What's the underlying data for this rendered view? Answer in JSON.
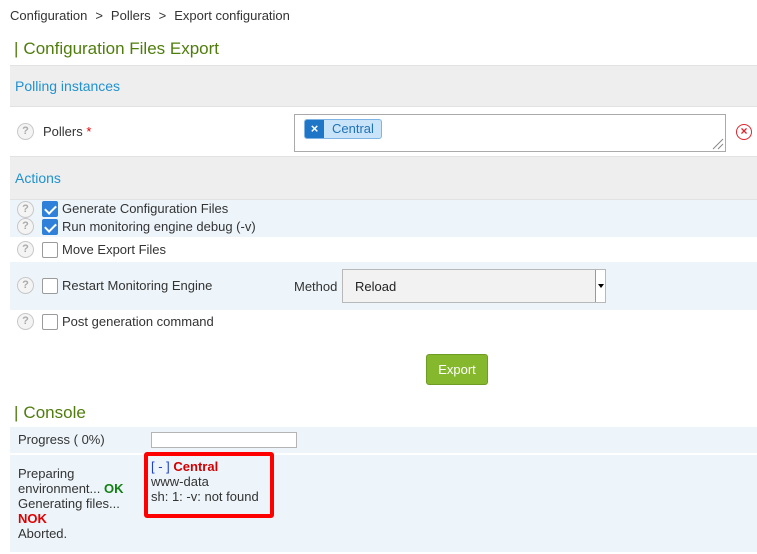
{
  "breadcrumb": {
    "items": [
      "Configuration",
      "Pollers",
      "Export configuration"
    ],
    "separator": ">"
  },
  "page_title": "Configuration Files Export",
  "polling_section": {
    "header": "Polling instances",
    "pollers_label": "Pollers",
    "required_mark": "*",
    "selected_pollers": [
      "Central"
    ],
    "remove_tag_symbol": "×"
  },
  "actions_section": {
    "header": "Actions",
    "items": [
      {
        "label": "Generate Configuration Files",
        "checked": true
      },
      {
        "label": "Run monitoring engine debug (-v)",
        "checked": true
      },
      {
        "label": "Move Export Files",
        "checked": false
      },
      {
        "label": "Restart Monitoring Engine",
        "checked": false
      },
      {
        "label": "Post generation command",
        "checked": false
      }
    ],
    "method_label": "Method",
    "method_value": "Reload"
  },
  "export_button": "Export",
  "console": {
    "title": "Console",
    "progress_label": "Progress ( 0%)",
    "progress_percent": 0,
    "status_lines": {
      "preparing": "Preparing environment...",
      "preparing_status": "OK",
      "generating": "Generating files...",
      "generating_status": "NOK",
      "aborted": "Aborted."
    },
    "output": {
      "toggle": "[ - ]",
      "poller": "Central",
      "line1": "www-data",
      "line2": "sh: 1: -v: not found"
    }
  },
  "help_symbol": "?",
  "colors": {
    "accent_green": "#4f7d0c",
    "section_blue": "#1f92cf",
    "button_green": "#85b82d",
    "ok_green": "#128012",
    "error_red": "#e00000",
    "highlight_red": "#ff0000",
    "checkbox_blue": "#2f80d8"
  }
}
